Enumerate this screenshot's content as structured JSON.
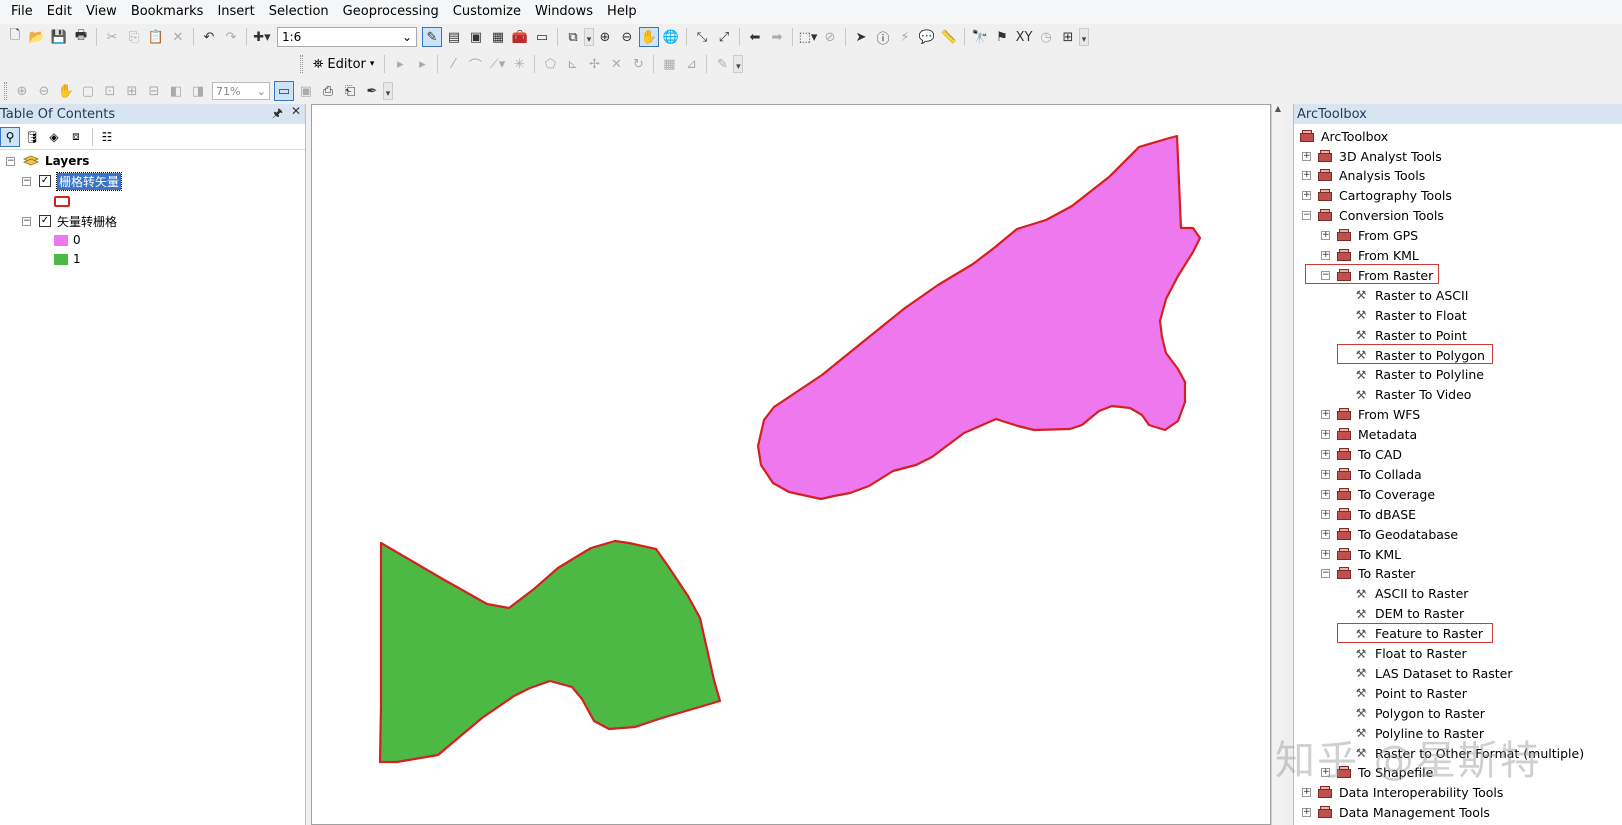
{
  "menu": [
    "File",
    "Edit",
    "View",
    "Bookmarks",
    "Insert",
    "Selection",
    "Geoprocessing",
    "Customize",
    "Windows",
    "Help"
  ],
  "toolbar": {
    "scale_value": "1:6",
    "editor_label": "Editor",
    "zoom_value": "71%"
  },
  "toc": {
    "title": "Table Of Contents",
    "pin_label": "ߨ",
    "close_label": "✕",
    "layers_label": "Layers",
    "layer1_name": "栅格转矢量",
    "layer2_name": "矢量转栅格",
    "class0_label": "0",
    "class1_label": "1"
  },
  "toolbox": {
    "title": "ArcToolbox",
    "root": "ArcToolbox",
    "items": [
      {
        "label": "3D Analyst Tools",
        "level": 0,
        "kind": "toolbox",
        "expander": "+"
      },
      {
        "label": "Analysis Tools",
        "level": 0,
        "kind": "toolbox",
        "expander": "+"
      },
      {
        "label": "Cartography Tools",
        "level": 0,
        "kind": "toolbox",
        "expander": "+"
      },
      {
        "label": "Conversion Tools",
        "level": 0,
        "kind": "toolbox",
        "expander": "-"
      },
      {
        "label": "From GPS",
        "level": 1,
        "kind": "toolset",
        "expander": "+"
      },
      {
        "label": "From KML",
        "level": 1,
        "kind": "toolset",
        "expander": "+"
      },
      {
        "label": "From Raster",
        "level": 1,
        "kind": "toolset",
        "expander": "-",
        "highlight": true
      },
      {
        "label": "Raster to ASCII",
        "level": 2,
        "kind": "tool"
      },
      {
        "label": "Raster to Float",
        "level": 2,
        "kind": "tool"
      },
      {
        "label": "Raster to Point",
        "level": 2,
        "kind": "tool"
      },
      {
        "label": "Raster to Polygon",
        "level": 2,
        "kind": "tool",
        "highlight": true
      },
      {
        "label": "Raster to Polyline",
        "level": 2,
        "kind": "tool"
      },
      {
        "label": "Raster To Video",
        "level": 2,
        "kind": "tool"
      },
      {
        "label": "From WFS",
        "level": 1,
        "kind": "toolset",
        "expander": "+"
      },
      {
        "label": "Metadata",
        "level": 1,
        "kind": "toolset",
        "expander": "+"
      },
      {
        "label": "To CAD",
        "level": 1,
        "kind": "toolset",
        "expander": "+"
      },
      {
        "label": "To Collada",
        "level": 1,
        "kind": "toolset",
        "expander": "+"
      },
      {
        "label": "To Coverage",
        "level": 1,
        "kind": "toolset",
        "expander": "+"
      },
      {
        "label": "To dBASE",
        "level": 1,
        "kind": "toolset",
        "expander": "+"
      },
      {
        "label": "To Geodatabase",
        "level": 1,
        "kind": "toolset",
        "expander": "+"
      },
      {
        "label": "To KML",
        "level": 1,
        "kind": "toolset",
        "expander": "+"
      },
      {
        "label": "To Raster",
        "level": 1,
        "kind": "toolset",
        "expander": "-"
      },
      {
        "label": "ASCII to Raster",
        "level": 2,
        "kind": "tool"
      },
      {
        "label": "DEM to Raster",
        "level": 2,
        "kind": "tool"
      },
      {
        "label": "Feature to Raster",
        "level": 2,
        "kind": "tool",
        "highlight": true
      },
      {
        "label": "Float to Raster",
        "level": 2,
        "kind": "tool"
      },
      {
        "label": "LAS Dataset to Raster",
        "level": 2,
        "kind": "tool"
      },
      {
        "label": "Point to Raster",
        "level": 2,
        "kind": "tool"
      },
      {
        "label": "Polygon to Raster",
        "level": 2,
        "kind": "tool"
      },
      {
        "label": "Polyline to Raster",
        "level": 2,
        "kind": "tool"
      },
      {
        "label": "Raster to Other Format (multiple)",
        "level": 2,
        "kind": "tool"
      },
      {
        "label": "To Shapefile",
        "level": 1,
        "kind": "toolset",
        "expander": "+"
      },
      {
        "label": "Data Interoperability Tools",
        "level": 0,
        "kind": "toolbox",
        "expander": "+"
      },
      {
        "label": "Data Management Tools",
        "level": 0,
        "kind": "toolbox",
        "expander": "+"
      }
    ]
  },
  "watermark": "知乎 @星斯特",
  "colors": {
    "class0_fill": "#ee78ee",
    "class1_fill": "#4cb944",
    "outline": "#d42020",
    "highlight_box": "#d23a3a"
  }
}
